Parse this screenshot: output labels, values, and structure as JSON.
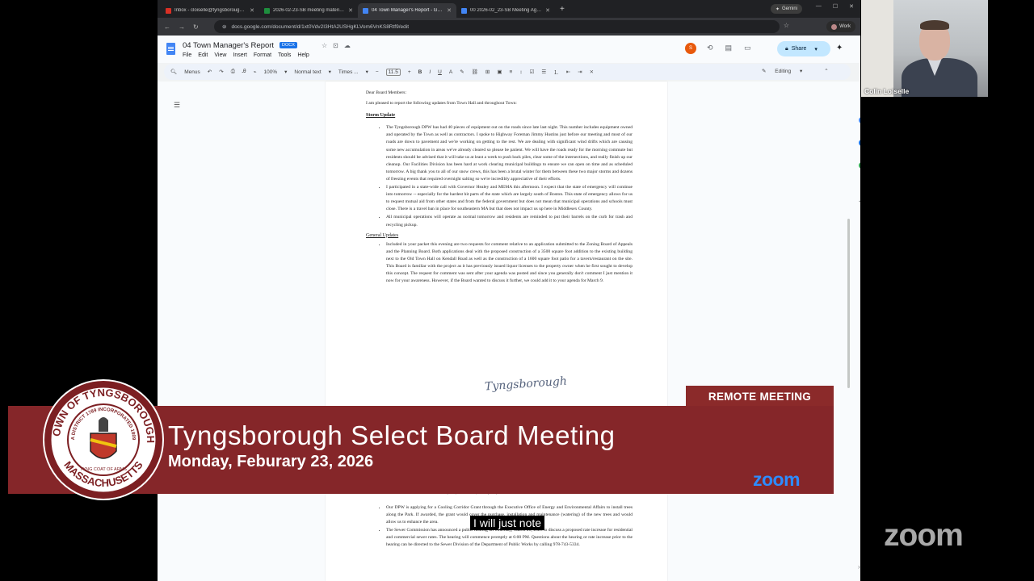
{
  "browser": {
    "tabs": [
      {
        "title": "Inbox - cloiselle@tyngsboroughma.gov",
        "color": "#d93025"
      },
      {
        "title": "2026-02-23-SB meeting materials",
        "color": "#1e8e3e"
      },
      {
        "title": "04 Town Manager's Report - Google Docs",
        "color": "#4285f4",
        "active": true
      },
      {
        "title": "00 2026-02_23-SB Meeting Agenda",
        "color": "#4285f4"
      }
    ],
    "new_tab": "+",
    "gemini": "Gemini",
    "url": "docs.google.com/document/d/1xt0Vdv2I3HtA2USHgKLVom6VnKS8Rtf9/edit",
    "profile": "Work"
  },
  "doc": {
    "title": "04 Town Manager's Report",
    "badge": "DOCX",
    "menus": [
      "File",
      "Edit",
      "View",
      "Insert",
      "Format",
      "Tools",
      "Help"
    ],
    "avatar": "S",
    "share": "Share",
    "toolbar": {
      "menus": "Menus",
      "zoom": "100%",
      "style": "Normal text",
      "font": "Times ...",
      "size": "11.5",
      "mode": "Editing"
    },
    "greeting": "Dear Board Members:",
    "intro": "I am pleased to report the following updates from Town Hall and throughout Town:",
    "storm_heading": "Storm Update",
    "storm_bullets": [
      "The Tyngsborough DPW has had 40 pieces of equipment out on the roads since late last night. This number includes equipment owned and operated by the Town as well as contractors. I spoke to Highway Foreman Jimmy Hustins just before our meeting and most of our roads are down to pavement and we're working on getting to the rest. We are dealing with significant wind drifts which are causing some new accumulation in areas we've already cleared so please be patient. We will have the roads ready for the morning commute but residents should be advised that it will take us at least a week to push back piles, clear some of the intersections, and really finish up our cleanup. Our Facilities Division has been hard at work clearing municipal buildings to ensure we can open on time and as scheduled tomorrow. A big thank you to all of our snow crews, this has been a brutal winter for them between these two major storms and dozens of freezing events that required overnight salting so we're incredibly appreciative of their efforts.",
      "I participated in a state-wide call with Governor Healey and MEMA this afternoon. I expect that the state of emergency will continue into tomorrow -- especially for the hardest hit parts of the state which are largely south of Boston. This state of emergency allows for us to request mutual aid from other states and from the federal government but does not mean that municipal operations and schools must close. There is a travel ban in place for southeastern MA but that does not impact us up here in Middlesex County.",
      "All municipal operations will operate as normal tomorrow and residents are reminded to put their barrels on the curb for trash and recycling pickup."
    ],
    "general_heading": "General Updates",
    "general_bullets": [
      "Included in your packet this evening are two requests for comment relative to an application submitted to the Zoning Board of Appeals and the Planning Board. Both applications deal with the proposed construction of a 3500 square foot addition to the existing building next to the Old Town Hall on Kendall Road as well as the construction of a 1600 square foot patio for a tavern/restaurant on the site. This Board is familiar with the project as it has previously issued liquor licenses to the property owner when he first sought to develop this concept. The request for comment was sent after your agenda was posted and since you generally don't comment I just mention it now for your awareness. However, if the Board wanted to discuss it further, we could add it to your agenda for March 9."
    ],
    "signature": "Tyngsborough",
    "address_line": "Tel: (978) 649-2314 | Fax: (978) 649-2320",
    "page2_bullets": [
      "Our DPW is applying for a Cooling Corridor Grant through the Executive Office of Energy and Environmental Affairs to install trees along the Park. If awarded, the grant would cover the purchase, installation and maintenance (watering) of the new trees and would allow us to enhance the area.",
      "The Sewer Commission has announced a public hearing on Thursday, March 26, 2026 to discuss a proposed rate increase for residential and commercial sewer rates. The hearing will commence promptly at 6:00 PM. Questions about the hearing or rate increase prior to the hearing can be directed to the Sewer Division of the Department of Public Works by calling 978-743-5334."
    ]
  },
  "webcam": {
    "name": "Colin Loiselle"
  },
  "overlay": {
    "remote": "REMOTE MEETING",
    "title": "Tyngsborough Select Board Meeting",
    "date": "Monday, Feburary 23, 2026",
    "zoom_small": "zoom",
    "zoom_big": "zoom",
    "caption": "I will just note",
    "seal": {
      "top_text": "TOWN OF TYNGSBOROUGH",
      "bottom_text": "MASSACHUSETTS",
      "inner_text": "A DISTRICT 1789 INCORPORATED 1809",
      "coat": "TYNG COAT OF ARMS"
    }
  },
  "colors": {
    "banner": "#852629",
    "remote": "#8b2a2a",
    "zoom": "#2d8cff"
  }
}
